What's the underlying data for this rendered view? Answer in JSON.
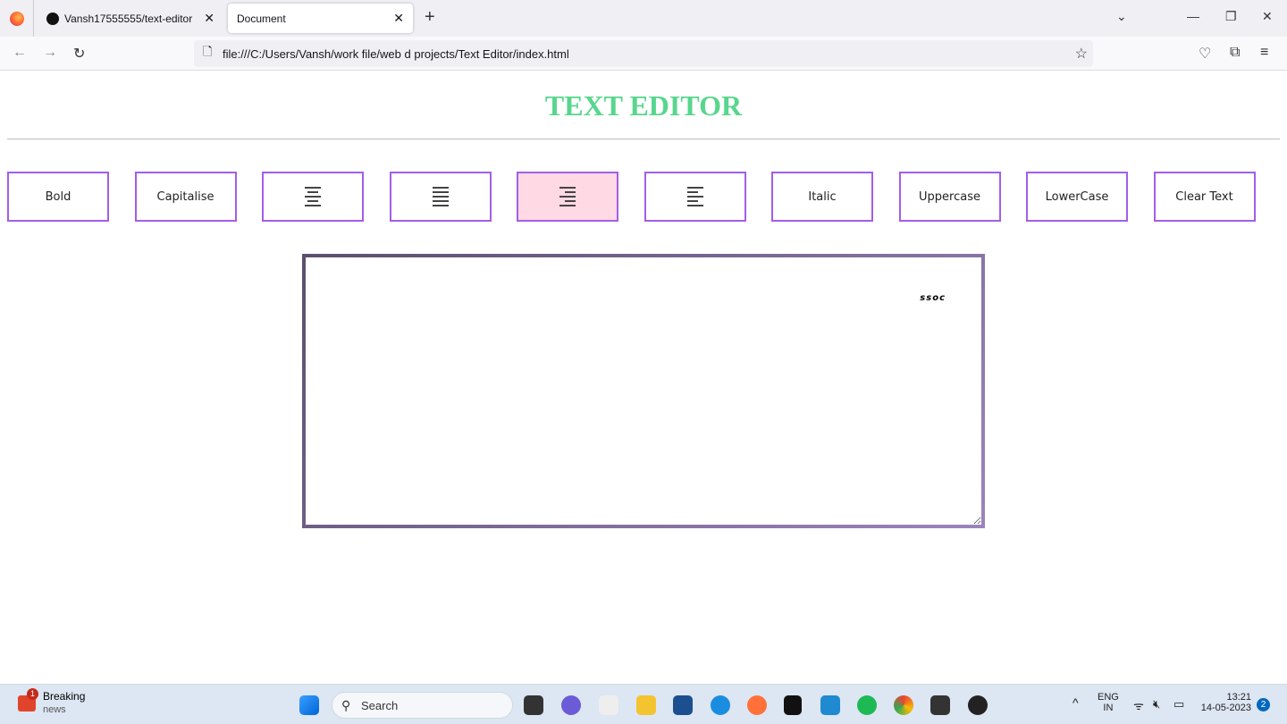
{
  "browser": {
    "tabs": [
      {
        "label": "Vansh17555555/text-editor",
        "close": "✕"
      },
      {
        "label": "Document",
        "close": "✕",
        "active": true
      }
    ],
    "new_tab": "+",
    "url": "file:///C:/Users/Vansh/work file/web d projects/Text Editor/index.html"
  },
  "page": {
    "title": "TEXT EDITOR",
    "title_color": "#58d68d",
    "buttons": [
      {
        "label": "Bold"
      },
      {
        "label": "Capitalise"
      },
      {
        "icon": "align-center-icon"
      },
      {
        "icon": "align-justify-icon"
      },
      {
        "icon": "align-right-icon",
        "active": true
      },
      {
        "icon": "align-left-icon"
      },
      {
        "label": "Italic"
      },
      {
        "label": "Uppercase"
      },
      {
        "label": "LowerCase"
      },
      {
        "label": "Clear Text"
      }
    ],
    "button_border_color": "#a35ee8",
    "active_button_color": "#ffd9e3",
    "textarea_value": "ssoc"
  },
  "taskbar": {
    "news_title": "Breaking",
    "news_sub": "news",
    "news_badge": "1",
    "search_label": "Search",
    "lang": "ENG",
    "region": "IN",
    "time": "13:21",
    "date": "14-05-2023",
    "notif_count": "2"
  }
}
